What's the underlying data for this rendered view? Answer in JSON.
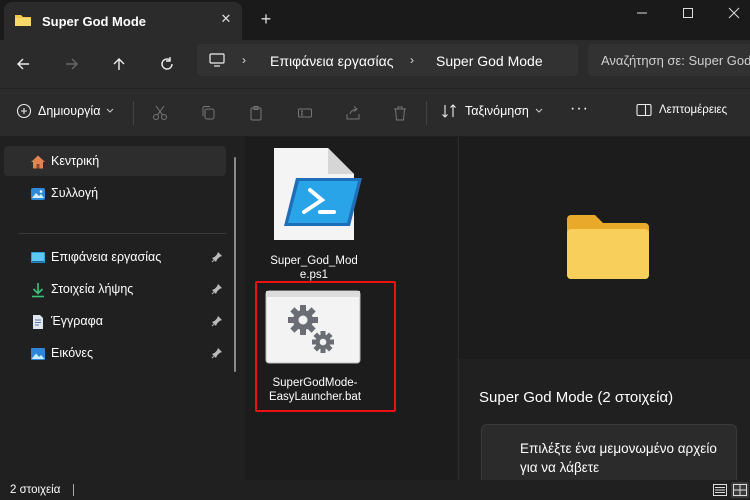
{
  "window": {
    "tab_title": "Super God Mode",
    "accent": "#f0c040"
  },
  "address": {
    "crumbs": [
      "Επιφάνεια εργασίας",
      "Super God Mode"
    ],
    "search_placeholder": "Αναζήτηση σε: Super God Mode"
  },
  "toolbar": {
    "new_label": "Δημιουργία",
    "sort_label": "Ταξινόμηση",
    "more_label": "···",
    "details_label": "Λεπτομέρειες"
  },
  "sidebar": {
    "items": [
      {
        "label": "Κεντρική",
        "icon": "home-icon"
      },
      {
        "label": "Συλλογή",
        "icon": "gallery-icon"
      },
      {
        "label": "Επιφάνεια εργασίας",
        "icon": "desktop-icon"
      },
      {
        "label": "Στοιχεία λήψης",
        "icon": "download-icon"
      },
      {
        "label": "Έγγραφα",
        "icon": "documents-icon"
      },
      {
        "label": "Εικόνες",
        "icon": "pictures-icon"
      }
    ]
  },
  "files": [
    {
      "label": "Super_God_Mode.ps1",
      "label_line1": "Super_God_Mod",
      "label_line2": "e.ps1",
      "icon": "powershell-script-icon"
    },
    {
      "label": "SuperGodMode-EasyLauncher.bat",
      "label_line1": "SuperGodMode-",
      "label_line2": "EasyLauncher.bat",
      "icon": "batch-file-icon"
    }
  ],
  "details": {
    "title": "Super God Mode (2 στοιχεία)",
    "message": "Επιλέξτε ένα μεμονωμένο αρχείο για να λάβετε"
  },
  "status": {
    "count": "2 στοιχεία"
  }
}
